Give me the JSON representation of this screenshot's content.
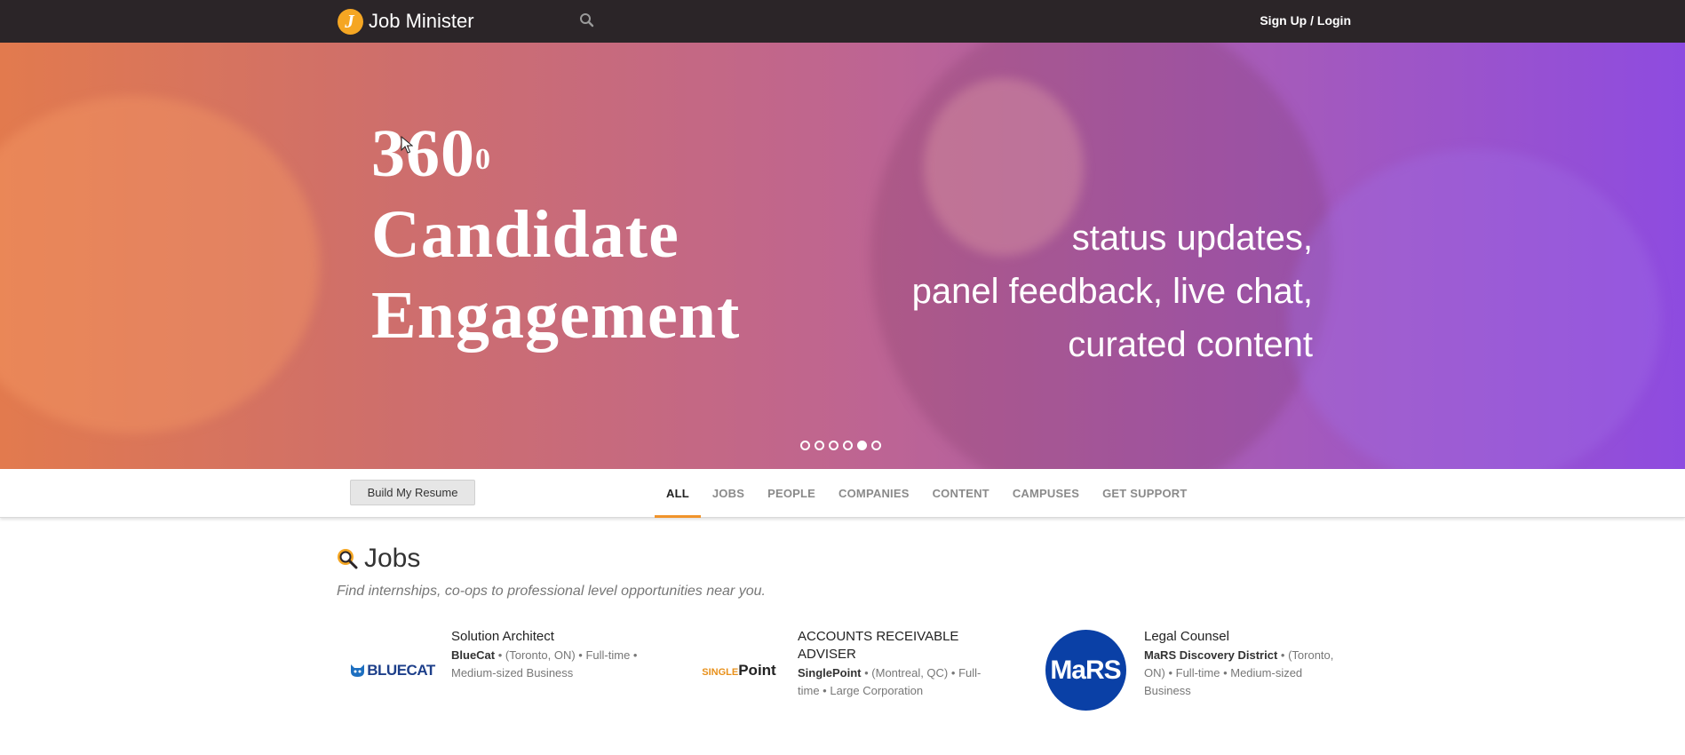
{
  "header": {
    "brand_letter": "J",
    "brand_name": "Job Minister",
    "login_label": "Sign Up / Login",
    "icons": {
      "search": "search-icon",
      "logo": "job-minister-logo"
    }
  },
  "hero": {
    "title_line1": "360",
    "title_degree": "0",
    "title_line2": "Candidate",
    "title_line3": "Engagement",
    "tagline_line1": "status updates,",
    "tagline_line2": "panel feedback, live chat,",
    "tagline_line3": "curated content",
    "slide_count": 6,
    "active_slide": 5
  },
  "filterbar": {
    "resume_button": "Build My Resume",
    "tabs": [
      {
        "label": "ALL",
        "active": true
      },
      {
        "label": "JOBS",
        "active": false
      },
      {
        "label": "PEOPLE",
        "active": false
      },
      {
        "label": "COMPANIES",
        "active": false
      },
      {
        "label": "CONTENT",
        "active": false
      },
      {
        "label": "CAMPUSES",
        "active": false
      },
      {
        "label": "GET SUPPORT",
        "active": false
      }
    ]
  },
  "jobs": {
    "title": "Jobs",
    "subtitle": "Find internships, co-ops to professional level opportunities near you.",
    "items": [
      {
        "title": "Solution Architect",
        "company": "BlueCat",
        "location": "(Toronto, ON)",
        "meta": "Full-time • Medium-sized Business",
        "logo_text": "BLUECAT"
      },
      {
        "title": "ACCOUNTS RECEIVABLE ADVISER",
        "company": "SinglePoint",
        "location": "(Montreal, QC)",
        "meta": "Full-time • Large Corporation",
        "logo_text_small": "SINGLE",
        "logo_text_big": "Point"
      },
      {
        "title": "Legal Counsel",
        "company": "MaRS Discovery District",
        "location": "(Toronto, ON)",
        "meta": "Full-time • Medium-sized Business",
        "logo_text": "MaRS"
      }
    ]
  },
  "colors": {
    "topbar": "#2b2528",
    "accent_orange": "#f0932b",
    "hero_start": "#e27a4e",
    "hero_end": "#8e4be0",
    "bluecat_blue": "#1d3f8a",
    "mars_blue": "#0a40a6"
  }
}
